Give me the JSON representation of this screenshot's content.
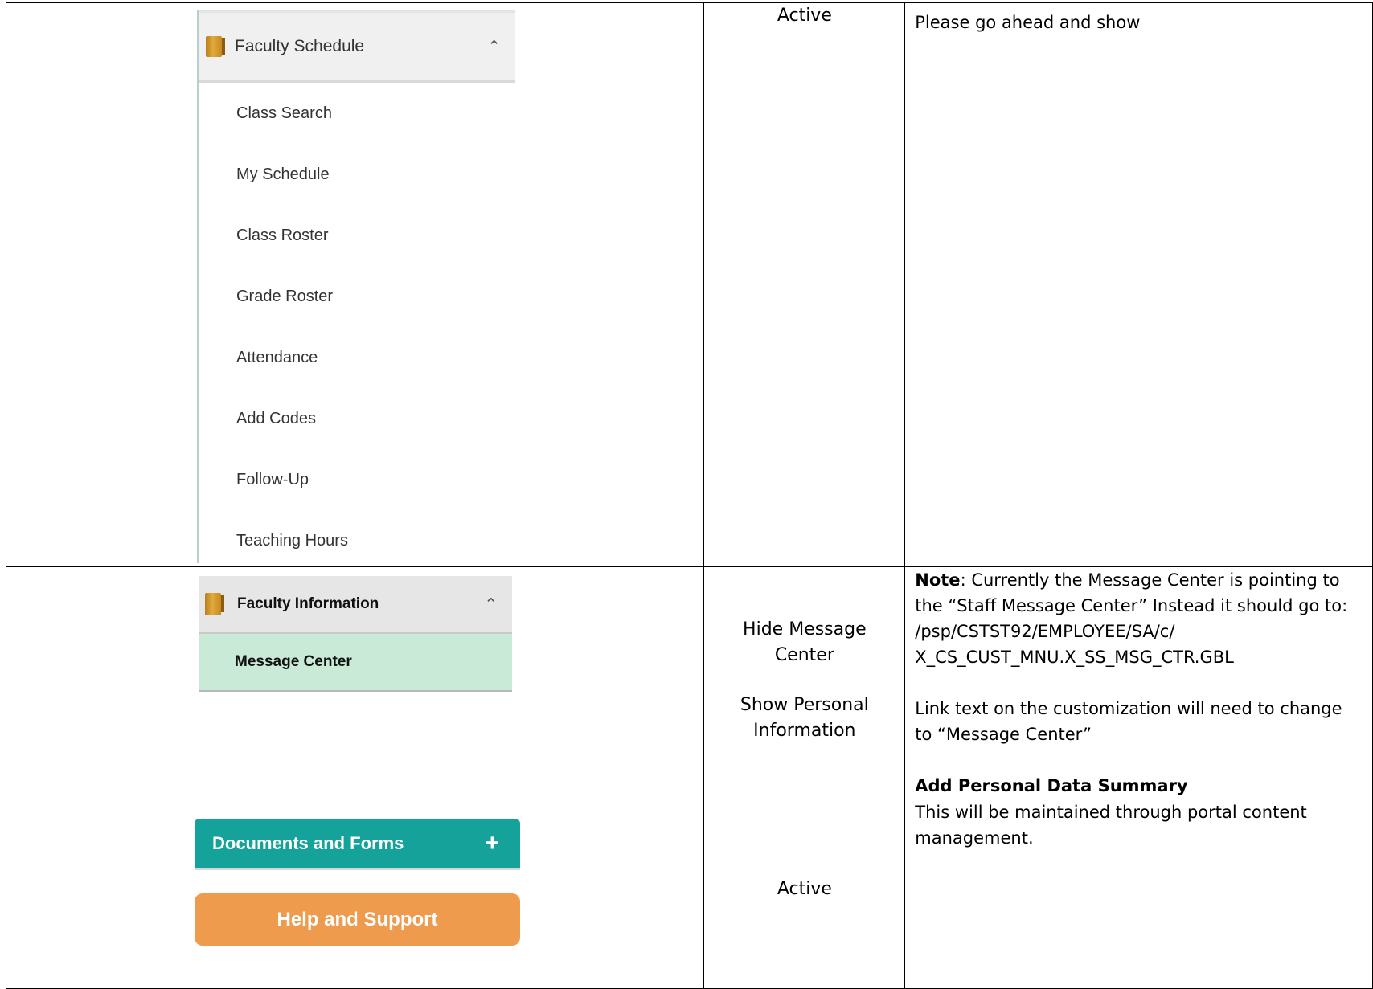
{
  "row1": {
    "menu": {
      "title": "Faculty Schedule",
      "items": [
        "Class Search",
        "My Schedule",
        "Class Roster",
        "Grade Roster",
        "Attendance",
        "Add Codes",
        "Follow-Up",
        "Teaching Hours"
      ]
    },
    "status": "Active",
    "notes": "Please go ahead and show"
  },
  "row2": {
    "menu": {
      "title": "Faculty Information",
      "item": "Message Center"
    },
    "status_line1": "Hide Message Center",
    "status_line2": "Show Personal Information",
    "note_label": "Note",
    "note_text": ": Currently the Message Center is pointing to the “Staff Message Center” Instead it should go to: /psp/CSTST92/EMPLOYEE/SA/c/ X_CS_CUST_MNU.X_SS_MSG_CTR.GBL",
    "link_text_note": "Link text on the customization will need to change to “Message Center”",
    "add_summary": "Add Personal Data Summary"
  },
  "row3": {
    "docs_button": "Documents and Forms",
    "docs_plus": "+",
    "help_button": "Help and Support",
    "status": "Active",
    "notes": "This will be maintained through portal content management."
  },
  "icons": {
    "folder": "folder-icon",
    "chevron": "chevron-up-icon",
    "plus": "plus-icon"
  },
  "colors": {
    "docs_button": "#14a29a",
    "help_button": "#ee9b4e",
    "selected_item": "#c8ead7",
    "folder": "#d9a030"
  }
}
